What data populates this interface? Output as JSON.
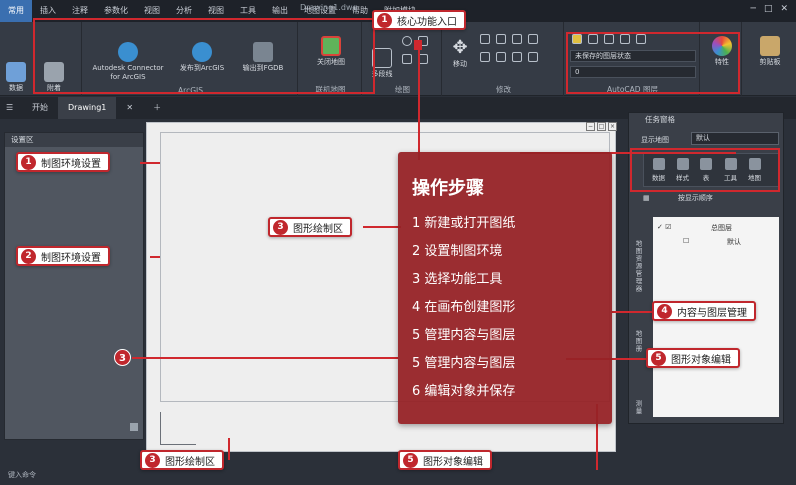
{
  "window": {
    "title": "Drawing1.dwg"
  },
  "menu_tabs": [
    "常用",
    "插入",
    "注释",
    "参数化",
    "视图",
    "分析",
    "视图",
    "工具",
    "输出",
    "地图设置",
    "帮助",
    "附加模块"
  ],
  "ribbon": {
    "home_buttons": [
      "数据",
      "附着"
    ],
    "arcgis": {
      "connector_label": "Autodesk Connector for ArcGIS",
      "publish_label": "发布到ArcGIS",
      "export_label": "输出到FGDB",
      "group_label": "ArcGIS"
    },
    "map_group": {
      "button_label": "关闭地图",
      "group_label": "联机地图"
    },
    "draw_group": {
      "button_label": "多段线",
      "group_label": "绘图"
    },
    "modify_group": {
      "button_label": "移动",
      "group_label": "修改"
    },
    "layer_group": {
      "state_label": "未保存的图层状态",
      "layer_value": "0",
      "group_label": "AutoCAD 图层"
    },
    "properties_label": "特性",
    "clipboard_label": "剪贴板"
  },
  "doc_tabs": [
    "开始",
    "Drawing1"
  ],
  "left_panel": {
    "title": "设置区"
  },
  "right_panel": {
    "title": "任务窗格",
    "display_label": "显示地图",
    "display_value": "默认",
    "tools": [
      "数据",
      "样式",
      "表",
      "工具",
      "地图"
    ],
    "sub_toolbar_label": "按显示顺序",
    "tree": [
      "总图层",
      "默认"
    ],
    "vertical_tabs": [
      "地图资源管理器",
      "地图册",
      "测量"
    ]
  },
  "command_line": "键入命令",
  "steps": {
    "title": "操作步骤",
    "items": [
      "1  新建或打开图纸",
      "2  设置制图环境",
      "3  选择功能工具",
      "4  在画布创建图形",
      "5  管理内容与图层",
      "5  管理内容与图层",
      "6  编辑对象并保存"
    ]
  },
  "annotations": {
    "ribbon": {
      "num": "1",
      "label": "核心功能入口"
    },
    "env1": {
      "num": "1",
      "label": "制图环境设置"
    },
    "env2": {
      "num": "2",
      "label": "制图环境设置"
    },
    "canvas_mid": {
      "num": "3",
      "label": "图形绘制区"
    },
    "canvas_bottom": {
      "num": "3",
      "label": "图形绘制区"
    },
    "canvas_left_num": "3",
    "content": {
      "num": "4",
      "label": "内容与图层管理"
    },
    "edit_right": {
      "num": "5",
      "label": "图形对象编辑"
    },
    "edit_bottom": {
      "num": "5",
      "label": "图形对象编辑"
    }
  },
  "colors": {
    "accent_red": "#c0272d",
    "steps_bg": "#962226",
    "ui_dark": "#2b3039"
  }
}
